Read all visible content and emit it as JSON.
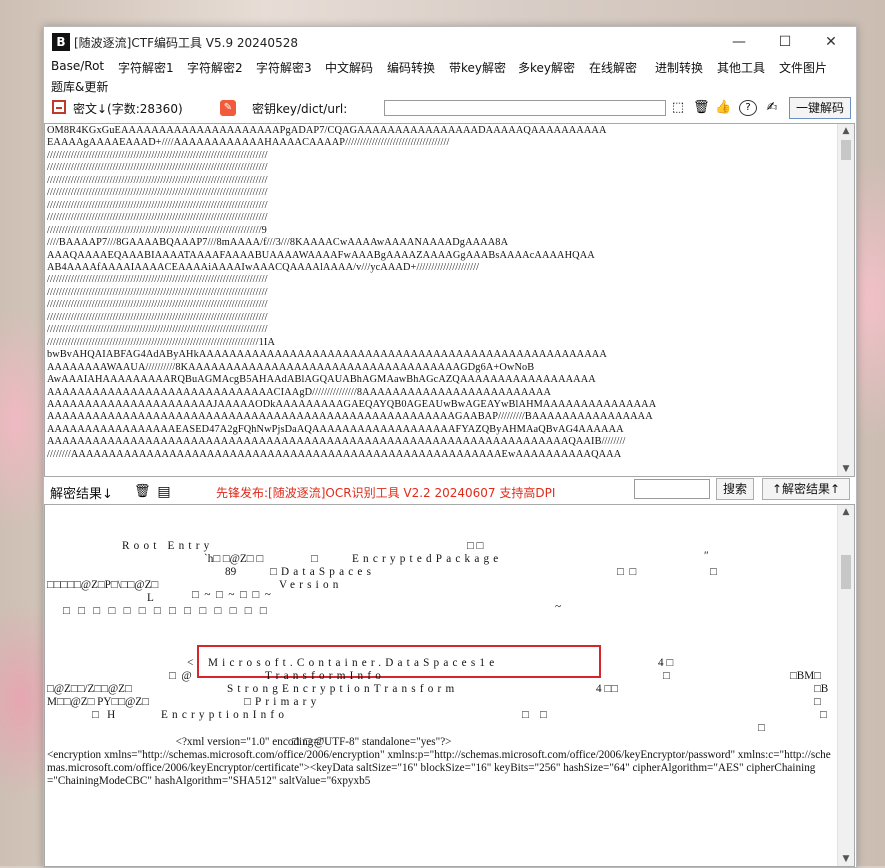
{
  "window": {
    "title": "[随波逐流]CTF编码工具 V5.9 20240528",
    "logo": "B",
    "controls": {
      "minimize": "—",
      "maximize": "☐",
      "close": "✕"
    }
  },
  "menu": {
    "items": [
      "Base/Rot",
      "字符解密1",
      "字符解密2",
      "字符解密3",
      "中文解码",
      "编码转换",
      "带key解密",
      "多key解密",
      "在线解密",
      "进制转换",
      "其他工具",
      "文件图片"
    ],
    "second_row": [
      "题库&更新"
    ]
  },
  "toolbar": {
    "cipher_label": "密文↓(字数:28360)",
    "key_label": "密钥key/dict/url:",
    "key_value": "",
    "decode_button": "一键解码"
  },
  "cipher": {
    "lines": [
      "OM8R4KGxGuEAAAAAAAAAAAAAAAAAAAAAPgADAP7/CQAGAAAAAAAAAAAAAAAADAAAAAQAAAAAAAAAA",
      "EAAAAgAAAAEAAAD+////AAAAAAAAAAAAHAAAACAAAAP///////////////////////////////////",
      "//////////////////////////////////////////////////////////////////////////",
      "//////////////////////////////////////////////////////////////////////////",
      "//////////////////////////////////////////////////////////////////////////",
      "//////////////////////////////////////////////////////////////////////////",
      "//////////////////////////////////////////////////////////////////////////",
      "//////////////////////////////////////////////////////////////////////////",
      "////////////////////////////////////////////////////////////////////////9",
      "////BAAAAP7///8GAAAABQAAAP7///8mAAAA/f///3///8KAAAACwAAAAwAAAANAAAADgAAAA8A",
      "AAAQAAAAEQAAABIAAAATAAAAFAAAABUAAAAWAAAAFwAAABgAAAAZAAAAGgAAABsAAAAcAAAAHQAA",
      "AB4AAAAfAAAAIAAAACEAAAAiAAAAIwAAACQAAAAlAAAA/v///ycAAAD+/////////////////////",
      "//////////////////////////////////////////////////////////////////////////",
      "//////////////////////////////////////////////////////////////////////////",
      "//////////////////////////////////////////////////////////////////////////",
      "//////////////////////////////////////////////////////////////////////////",
      "//////////////////////////////////////////////////////////////////////////",
      "///////////////////////////////////////////////////////////////////////1IA",
      "bwBvAHQAIABFAG4AdAByAHkAAAAAAAAAAAAAAAAAAAAAAAAAAAAAAAAAAAAAAAAAAAAAAAAAAAAAA",
      "AAAAAAAAWAAUA//////////8KAAAAAAAAAAAAAAAAAAAAAAAAAAAAAAAAAAAAGDg6A+OwNoB",
      "AwAAAIAHAAAAAAAAARQBuAGMAcgB5AHAAdABlAGQAUABhAGMAawBhAGcAZQAAAAAAAAAAAAAAAAAA",
      "AAAAAAAAAAAAAAAAAAAAAAAAAAAAAACIAAgD///////////////8AAAAAAAAAAAAAAAAAAAAAAAAA",
      "AAAAAAAAAAAAAAAAAAAAAAJAAAAAODkAAAAAAAAAGAEQAYQB0AGEAUwBwAGEAYwBlAHMAAAAAAAAAAAAAAA",
      "AAAAAAAAAAAAAAAAAAAAAAAAAAAAAAAAAAAAAAAAAAAAAAAAAAAAAAGAABAP/////////BAAAAAAAAAAAAAAAA",
      "AAAAAAAAAAAAAAAAAEASED47A2gFQhNwPjsDaAQAAAAAAAAAAAAAAAAAAAFYAZQByAHMAaQBvAG4AAAAAA",
      "AAAAAAAAAAAAAAAAAAAAAAAAAAAAAAAAAAAAAAAAAAAAAAAAAAAAAAAAAAAAAAAAAAAAAQAAIB////////",
      "////////AAAAAAAAAAAAAAAAAAAAAAAAAAAAAAAAAAAAAAAAAAAAAAAAAAAAAAAAAEwAAAAAAAAAAQAAA"
    ]
  },
  "midbar": {
    "result_label": "解密结果↓",
    "notice": "先锋发布:[随波逐流]OCR识别工具 V2.2 20240607 支持高DPI",
    "search_value": "",
    "search_button": "搜索",
    "encode_button": "↑解密结果↑"
  },
  "result": {
    "line1": "Root Entry",
    "line1b": "□ □",
    "line2a": "`h□ □@Z□ □",
    "line2b": "□",
    "line2c": "EncryptedPackage",
    "line2d": "″",
    "line3a": "89",
    "line3b": "□DataSpaces",
    "line3c": "□  □",
    "line3d": "□",
    "line4a": "□□□□□@Z□P□\\□□@Z□",
    "line4b": "Version",
    "line5a": "L",
    "line5b": "□  ~  □  ~  □  □  ~",
    "line6": "□   □   □   □   □   □   □   □   □   □   □   □   □   □",
    "line6b": "~",
    "line7a": "<",
    "line7b": "Microsoft.Container.DataSpaces1e",
    "line7c": "4 □",
    "line8a": "□  @",
    "line8b": "TransformInfo",
    "line8c": "□",
    "line8d": "□BM□",
    "line9a": "□@Z□□/Z□□@Z□",
    "line9b": "StrongEncryptionTransform",
    "line9c": "4 □□",
    "line9d": "□B",
    "line10a": "M□□@Z□ PY□□@Z□",
    "line10b": "□Primary",
    "line10c": "□",
    "line11a": "□   H",
    "line11b": "EncryptionInfo",
    "line11c": "□    □",
    "line11d": "□",
    "line12": "□",
    "line13a": "□  □ @",
    "xml": "<?xml version=\"1.0\" encoding=\"UTF-8\" standalone=\"yes\"?>\n<encryption xmlns=\"http://schemas.microsoft.com/office/2006/encryption\" xmlns:p=\"http://schemas.microsoft.com/office/2006/keyEncryptor/password\" xmlns:c=\"http://schemas.microsoft.com/office/2006/keyEncryptor/certificate\"><keyData saltSize=\"16\" blockSize=\"16\" keyBits=\"256\" hashSize=\"64\" cipherAlgorithm=\"AES\" cipherChaining=\"ChainingModeCBC\" hashAlgorithm=\"SHA512\" saltValue=\"6xpyxb5"
  },
  "colors": {
    "notice": "#e02b1a",
    "highlight": "#d7262b"
  },
  "icons": [
    "app-logo-icon",
    "red-box-icon",
    "pen-icon",
    "cursor-icon",
    "trash-icon",
    "thumbs-up-icon",
    "help-icon",
    "edit-icon",
    "copy-icon"
  ]
}
